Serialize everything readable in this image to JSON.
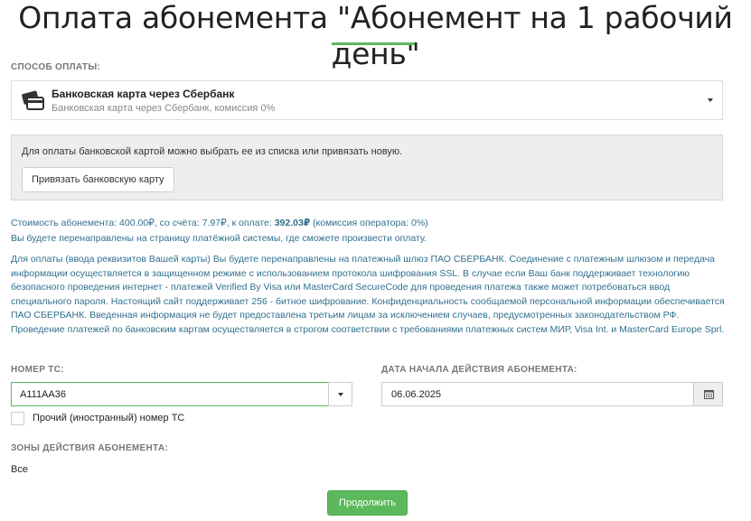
{
  "page": {
    "title": "Оплата абонемента \"Абонемент на 1 рабочий день\""
  },
  "payment": {
    "section_label": "СПОСОБ ОПЛАТЫ:",
    "selected_name": "Банковская карта через Сбербанк",
    "selected_sub": "Банковская карта через Сбербанк, комиссия 0%",
    "icon": "credit-card-icon"
  },
  "card_box": {
    "text": "Для оплаты банковской картой можно выбрать ее из списка  или привязать новую.",
    "bind_button_label": "Привязать банковскую карту"
  },
  "summary": {
    "prefix": "Стоимость абонемента: 400.00₽, со счёта: 7.97₽, к оплате: ",
    "amount": "392.03₽",
    "suffix": " (комиссия оператора: 0%)",
    "redirect": "Вы будете перенаправлены на страницу платёжной системы, где сможете произвести оплату."
  },
  "security_text": "Для оплаты (ввода реквизитов Вашей карты) Вы будете перенаправлены на платежный шлюз ПАО СБЕРБАНК. Соединение с платежным шлюзом и передача информации осуществляется в защищенном режиме с использованием протокола шифрования SSL. В случае если Ваш банк поддерживает технологию безопасного проведения интернет - платежей Verified By Visa или MasterCard SecureCode для проведения платежа также может потребоваться ввод специального пароля. Настоящий сайт поддерживает 256 - битное шифрование. Конфиденциальность сообщаемой персональной информации обеспечивается ПАО СБЕРБАНК. Введенная информация не будет предоставлена третьим лицам за исключением случаев, предусмотренных законодательством РФ. Проведение платежей по банковским картам осуществляется в строгом соответствии с требованиями платежных систем МИР, Visa Int. и MasterCard Europe Sprl.",
  "vehicle": {
    "label": "НОМЕР ТС:",
    "value": "А111АА36",
    "foreign_label": "Прочий (иностранный) номер ТС",
    "foreign_checked": false
  },
  "start_date": {
    "label": "ДАТА НАЧАЛА ДЕЙСТВИЯ АБОНЕМЕНТА:",
    "value": "06.06.2025",
    "icon": "calendar-icon"
  },
  "zones": {
    "label": "ЗОНЫ ДЕЙСТВИЯ АБОНЕМЕНТА:",
    "value": "Все"
  },
  "actions": {
    "continue_label": "Продолжить"
  },
  "colors": {
    "accent": "#5cb85c",
    "info_text": "#31708f"
  }
}
